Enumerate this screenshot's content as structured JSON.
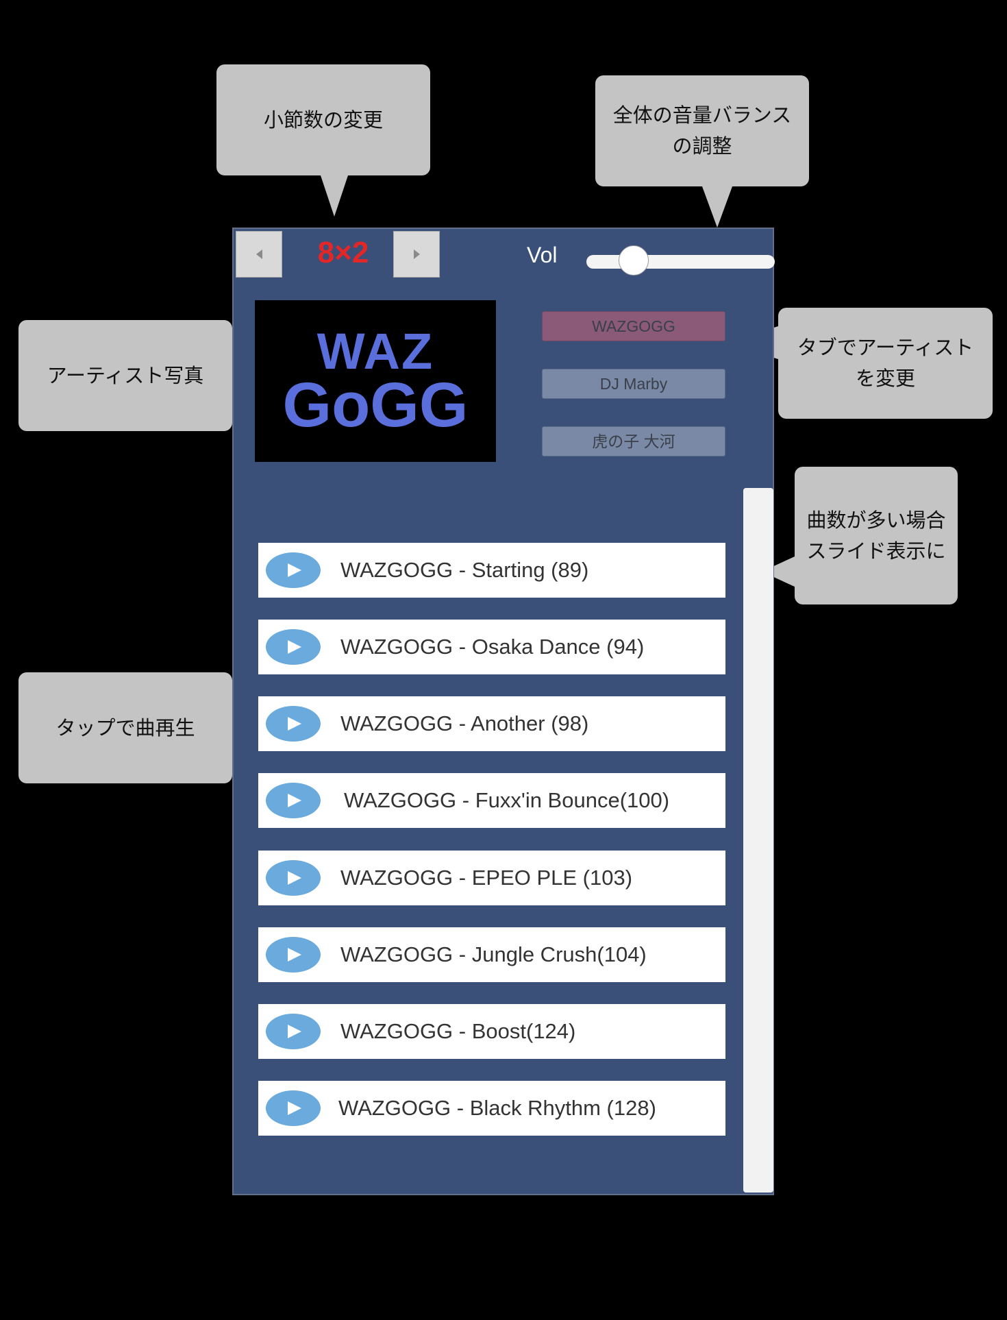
{
  "annotations": {
    "measure_change": "小節数の変更",
    "volume_balance_line1": "全体の音量バランス",
    "volume_balance_line2": "の調整",
    "artist_photo": "アーティスト写真",
    "tab_change_line1": "タブでアーティスト",
    "tab_change_line2": "を変更",
    "many_songs_line1": "曲数が多い場合",
    "many_songs_line2": "スライド表示に",
    "tap_play": "タップで曲再生"
  },
  "toolbar": {
    "prev_icon": "◈",
    "next_icon": "◈",
    "measure_value": "8×2",
    "vol_label": "Vol",
    "volume_level": 0.25
  },
  "artist_photo": {
    "logo_line1": "WAZ",
    "logo_line2": "GoGG"
  },
  "artist_tabs": [
    {
      "label": "WAZGOGG",
      "selected": true
    },
    {
      "label": "DJ Marby",
      "selected": false
    },
    {
      "label": "虎の子 大河",
      "selected": false
    }
  ],
  "songs": [
    {
      "label": "WAZGOGG - Starting (89)"
    },
    {
      "label": "WAZGOGG - Osaka Dance (94)"
    },
    {
      "label": "WAZGOGG - Another (98)"
    },
    {
      "label": "WAZGOGG - Fuxx'in Bounce(100)"
    },
    {
      "label": "WAZGOGG - EPEO PLE (103)"
    },
    {
      "label": "WAZGOGG - Jungle Crush(104)"
    },
    {
      "label": "WAZGOGG - Boost(124)"
    },
    {
      "label": "WAZGOGG - Black Rhythm (128)"
    }
  ],
  "colors": {
    "panel_bg": "#3a5079",
    "measure_text": "#e32626",
    "tab_selected": "#8a5a78",
    "tab_normal": "#7a8aa6",
    "play_button": "#6aaadd",
    "callout_bg": "#c4c4c4"
  }
}
